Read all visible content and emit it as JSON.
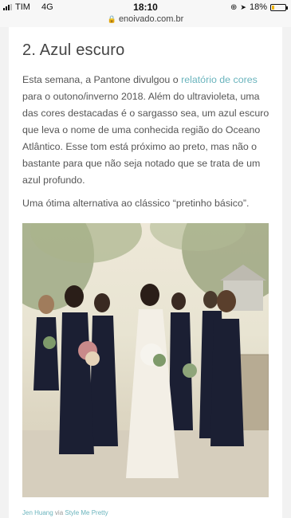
{
  "status_bar": {
    "carrier": "TIM",
    "network": "4G",
    "time": "18:10",
    "battery": "18%",
    "battery_level": 0.18
  },
  "url_bar": {
    "url": "enoivado.com.br"
  },
  "article": {
    "heading": "2. Azul escuro",
    "p1_before": "Esta semana, a Pantone divulgou o ",
    "p1_link": "relatório de cores",
    "p1_after": " para o outono/inverno 2018. Além do ultravioleta, uma das cores destacadas é o sargasso sea, um azul escuro que leva o nome de uma conhecida região do Oceano Atlântico. Esse tom está próximo ao preto, mas não o bastante para que não seja notado que se trata de um azul profundo.",
    "p2": "Uma ótima alternativa ao clássico “pretinho básico”.",
    "credit_name": "Jen Huang",
    "credit_via": " via ",
    "credit_source": "Style Me Pretty"
  },
  "colors": {
    "link": "#6ab4bd",
    "battery_fill": "#f0b400",
    "dress_navy": "#1b1f33"
  }
}
